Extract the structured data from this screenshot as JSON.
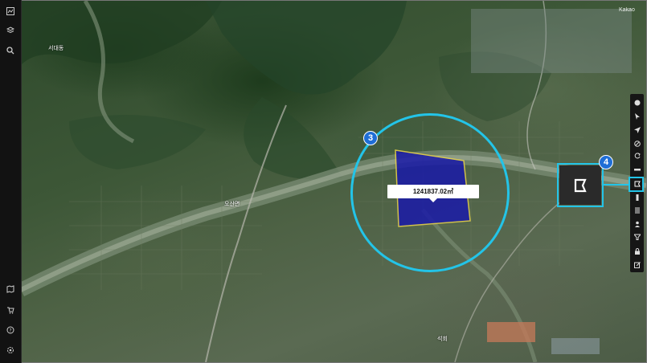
{
  "map": {
    "area_measurement": "1241837.02㎡",
    "place_labels": [
      "서대동",
      "오산면",
      "석회"
    ]
  },
  "annotations": {
    "circle_badge": "3",
    "tool_badge": "4"
  },
  "watermark": {
    "text": "Kakao"
  },
  "sidebar_left": {
    "top_icons": [
      "image-icon",
      "layers-icon",
      "search-icon"
    ],
    "bottom_icons": [
      "map-icon",
      "cart-icon",
      "help-icon",
      "settings-icon"
    ]
  },
  "toolbar_right": {
    "tools": [
      "circle-draw-icon",
      "pointer-icon",
      "navigate-icon",
      "compass-icon",
      "rotate-icon",
      "ruler-icon",
      "area-measure-icon",
      "marker-icon",
      "list-icon",
      "person-icon",
      "filter-icon",
      "lock-icon",
      "edit-icon"
    ],
    "highlighted_tool": "area-measure-icon"
  },
  "colors": {
    "accent_cyan": "#23c4e8",
    "badge_blue": "#1f6ed6",
    "polygon_fill": "#1a1aa8",
    "polygon_stroke": "#e8d24a"
  }
}
